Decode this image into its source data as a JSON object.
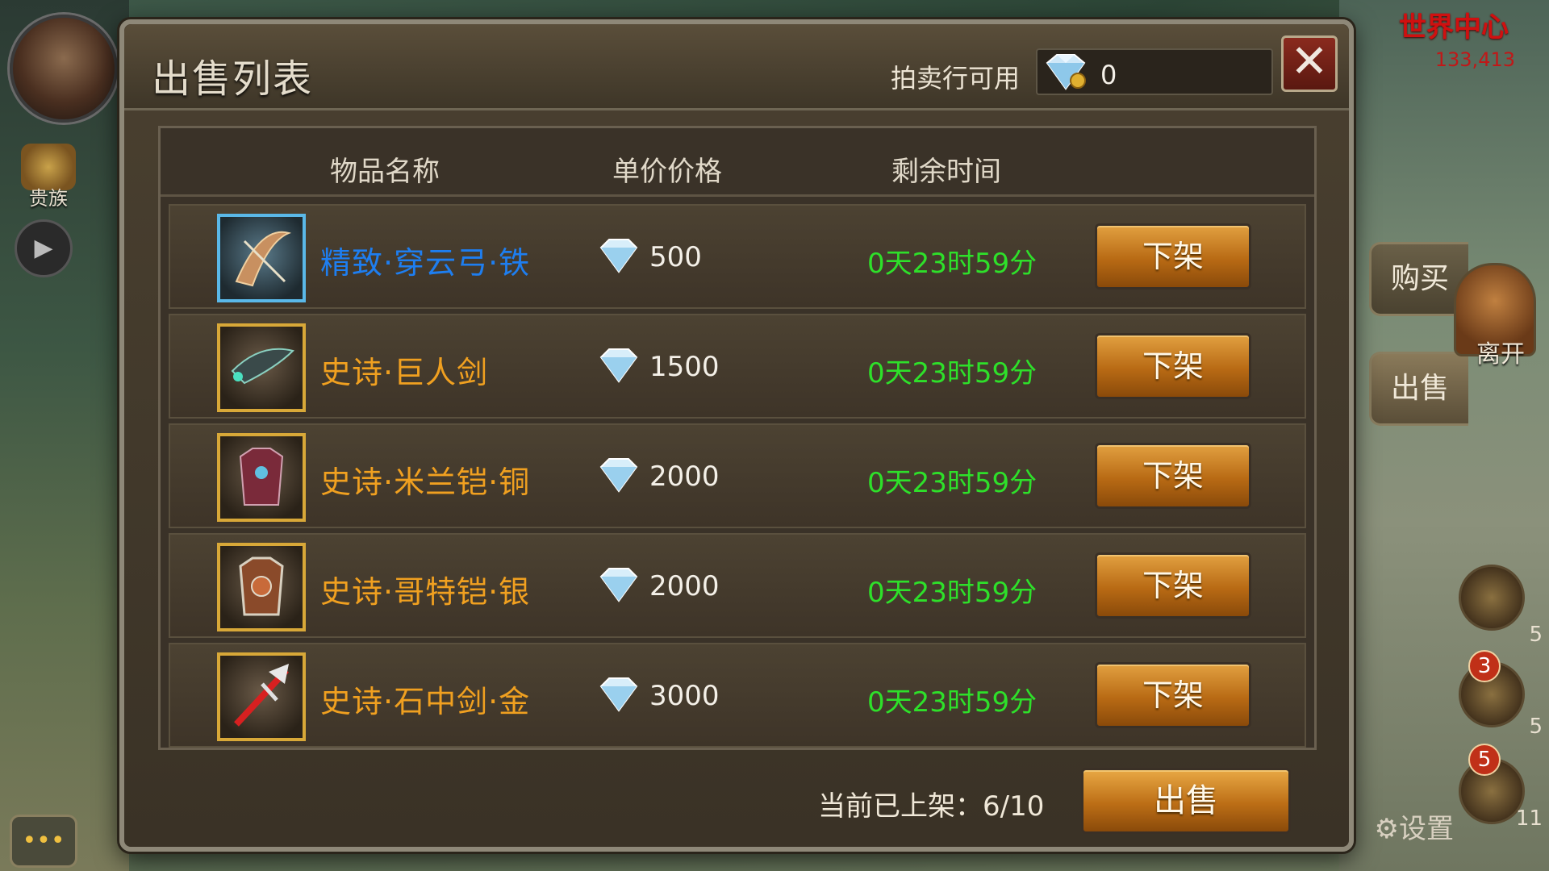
{
  "hud": {
    "noble_label": "贵族",
    "world_center": "世界中心",
    "world_count": "133,413",
    "buy_tab": "购买",
    "sell_tab": "出售",
    "leave_label": "离开",
    "settings_label": "设置",
    "badges": [
      "3",
      "5"
    ],
    "side_numbers": [
      "5",
      "5",
      "11"
    ]
  },
  "modal": {
    "title": "出售列表",
    "auction_label": "拍卖行可用",
    "auction_balance": "0",
    "close_symbol": "✕",
    "columns": {
      "name": "物品名称",
      "price": "单价价格",
      "time": "剩余时间"
    },
    "items": [
      {
        "name": "精致·穿云弓·铁",
        "price": "500",
        "time": "0天23时59分",
        "action": "下架",
        "rarity": "fine"
      },
      {
        "name": "史诗·巨人剑",
        "price": "1500",
        "time": "0天23时59分",
        "action": "下架",
        "rarity": "epic"
      },
      {
        "name": "史诗·米兰铠·铜",
        "price": "2000",
        "time": "0天23时59分",
        "action": "下架",
        "rarity": "epic"
      },
      {
        "name": "史诗·哥特铠·银",
        "price": "2000",
        "time": "0天23时59分",
        "action": "下架",
        "rarity": "epic"
      },
      {
        "name": "史诗·石中剑·金",
        "price": "3000",
        "time": "0天23时59分",
        "action": "下架",
        "rarity": "epic"
      }
    ],
    "listed_count": "当前已上架：6/10",
    "sell_button": "出售"
  },
  "colors": {
    "fine_name": "#1e7ef0",
    "epic_name": "#f0a020",
    "time_text": "#2ee02a",
    "button_orange": "#bc6e16"
  },
  "icons": {
    "currency": "diamond-icon",
    "close": "close-icon"
  }
}
